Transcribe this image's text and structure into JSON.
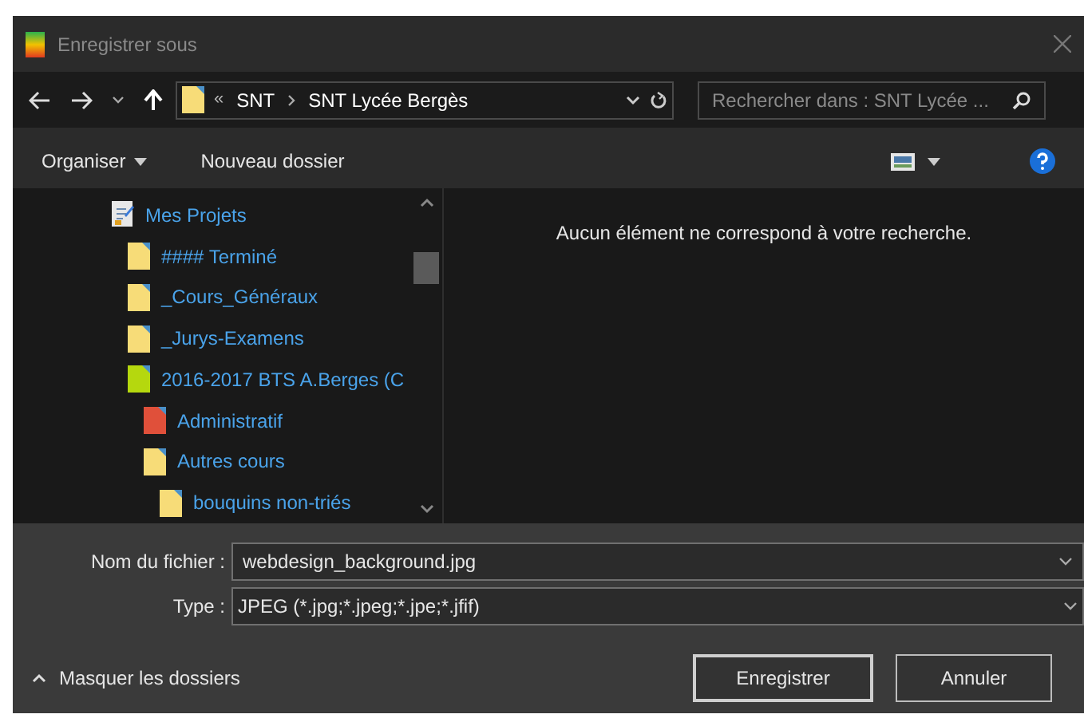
{
  "window": {
    "title": "Enregistrer sous"
  },
  "address_bar": {
    "overflow": "«",
    "path": [
      "SNT",
      "SNT Lycée Bergès"
    ]
  },
  "search": {
    "placeholder": "Rechercher dans : SNT Lycée ..."
  },
  "toolbar": {
    "organize": "Organiser",
    "new_folder": "Nouveau dossier"
  },
  "tree": [
    {
      "label": "Mes Projets",
      "kind": "document",
      "children": [
        {
          "label": "#### Terminé",
          "kind": "folder",
          "color": "#f7dc78"
        },
        {
          "label": "_Cours_Généraux",
          "kind": "folder",
          "color": "#f7dc78"
        },
        {
          "label": "_Jurys-Examens",
          "kind": "folder",
          "color": "#f7dc78"
        },
        {
          "label": "2016-2017 BTS A.Berges (C",
          "kind": "folder",
          "color": "#b5d80e",
          "children": [
            {
              "label": "Administratif",
              "kind": "folder",
              "color": "#e0503a"
            },
            {
              "label": "Autres cours",
              "kind": "folder",
              "color": "#f7dc78",
              "children": [
                {
                  "label": "bouquins non-triés",
                  "kind": "folder",
                  "color": "#f7dc78"
                }
              ]
            }
          ]
        }
      ]
    }
  ],
  "empty_message": "Aucun élément ne correspond à votre recherche.",
  "file_name": {
    "label": "Nom du fichier :",
    "value": "webdesign_background.jpg"
  },
  "file_type": {
    "label": "Type :",
    "value": "JPEG (*.jpg;*.jpeg;*.jpe;*.jfif)"
  },
  "hide_folders": "Masquer les dossiers",
  "buttons": [
    {
      "label": "Enregistrer",
      "selected": true
    },
    {
      "label": "Annuler",
      "selected": false
    }
  ]
}
